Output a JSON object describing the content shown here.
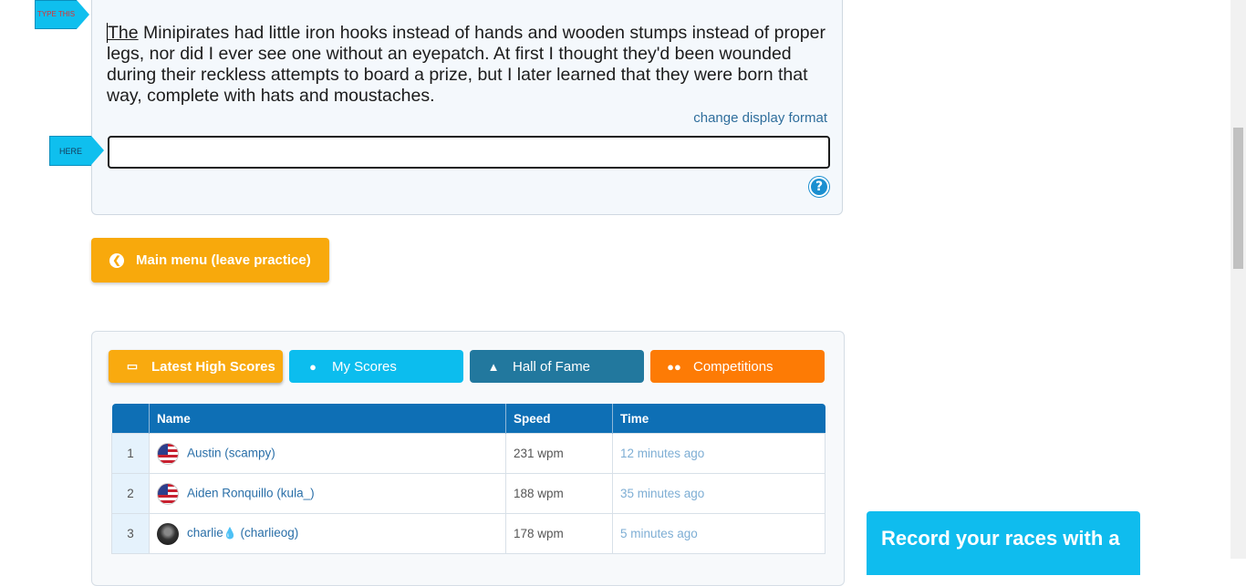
{
  "typing": {
    "tag_type": "TYPE THIS",
    "tag_here": "HERE",
    "first_word": "The",
    "passage_rest": " Minipirates had little iron hooks instead of hands and wooden stumps instead of proper legs, nor did I ever see one without an eyepatch. At first I thought they'd been wounded during their reckless attempts to board a prize, but I later learned that they were born that way, complete with hats and moustaches.",
    "display_link": "change display format",
    "input_value": "",
    "help_icon": "help-icon"
  },
  "main_menu_button": {
    "label": "Main menu (leave practice)",
    "icon": "chevron-left-circle-icon"
  },
  "scores": {
    "tabs": [
      {
        "label": "Latest High Scores",
        "icon": "monitor-icon",
        "color": "#f9aa0f"
      },
      {
        "label": "My Scores",
        "icon": "user-icon",
        "color": "#0cbdee"
      },
      {
        "label": "Hall of Fame",
        "icon": "thumbs-up-icon",
        "color": "#22789e"
      },
      {
        "label": "Competitions",
        "icon": "group-icon",
        "color": "#fd7b05"
      }
    ],
    "columns": {
      "rank": "",
      "name": "Name",
      "speed": "Speed",
      "time": "Time"
    },
    "rows": [
      {
        "rank": "1",
        "name": "Austin (scampy)",
        "avatar": "us-flag-icon",
        "speed": "231 wpm",
        "time": "12 minutes ago"
      },
      {
        "rank": "2",
        "name": "Aiden Ronquillo (kula_)",
        "avatar": "us-flag-icon",
        "speed": "188 wpm",
        "time": "35 minutes ago"
      },
      {
        "rank": "3",
        "name_prefix": "charlie",
        "name_suffix": " (charlieog)",
        "avatar": "user-avatar-icon",
        "speed": "178 wpm",
        "time": "5 minutes ago"
      }
    ]
  },
  "promo": {
    "text": "Record your races with a"
  }
}
